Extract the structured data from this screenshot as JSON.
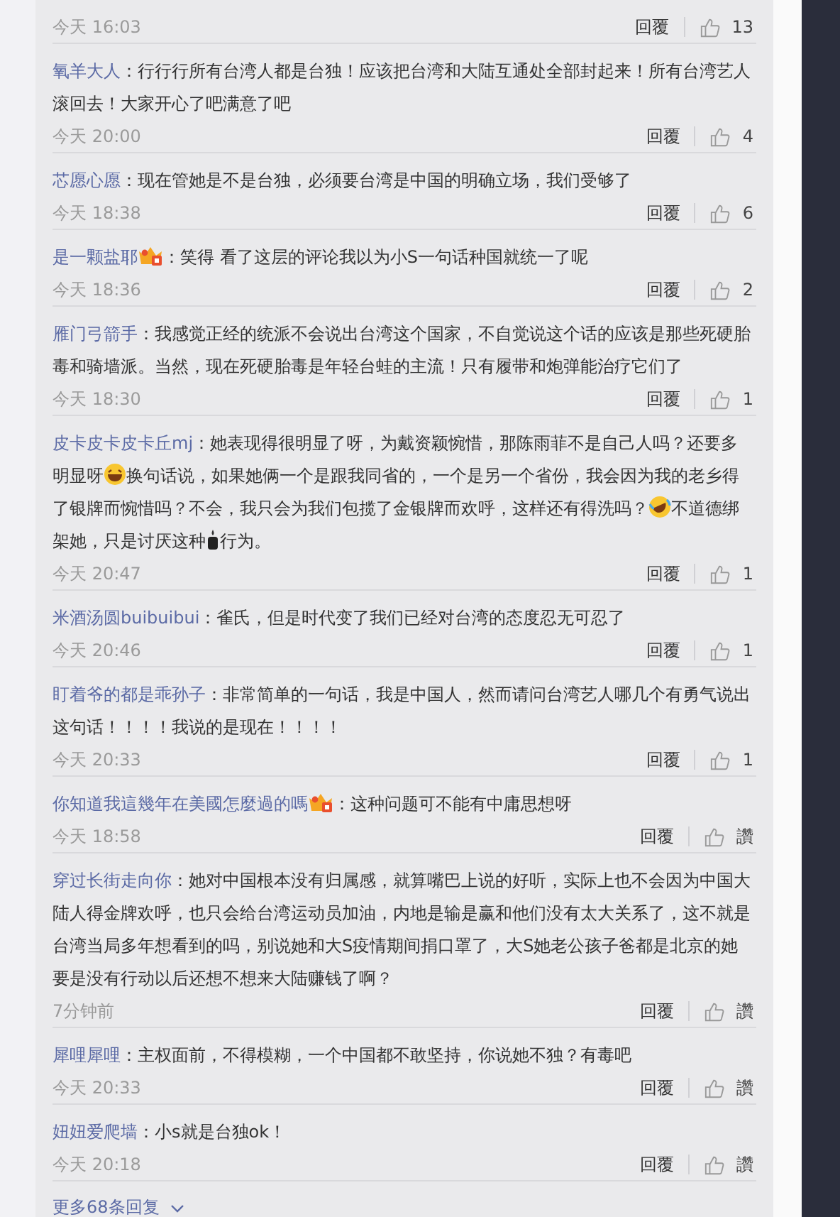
{
  "comments": [
    {
      "time": "今天 16:03",
      "reply": "回覆",
      "likes": "13"
    },
    {
      "user": "氧羊大人",
      "vip_badge": false,
      "parts": [
        {
          "kind": "text",
          "text": "：行行行所有台湾人都是台独！应该把台湾和大陆互通处全部封起来！所有台湾艺人滚回去！大家开心了吧满意了吧"
        }
      ],
      "time": "今天 20:00",
      "reply": "回覆",
      "likes": "4"
    },
    {
      "user": "芯愿心愿",
      "vip_badge": false,
      "parts": [
        {
          "kind": "text",
          "text": "：现在管她是不是台独，必须要台湾是中国的明确立场，我们受够了"
        }
      ],
      "time": "今天 18:38",
      "reply": "回覆",
      "likes": "6"
    },
    {
      "user": "是一颗盐耶",
      "vip_badge": true,
      "parts": [
        {
          "kind": "text",
          "text": "：笑得 看了这层的评论我以为小S一句话种国就统一了呢"
        }
      ],
      "time": "今天 18:36",
      "reply": "回覆",
      "likes": "2"
    },
    {
      "user": "雁门弓箭手",
      "vip_badge": false,
      "parts": [
        {
          "kind": "text",
          "text": "：我感觉正经的统派不会说出台湾这个国家，不自觉说这个话的应该是那些死硬胎毒和骑墙派。当然，现在死硬胎毒是年轻台蛙的主流！只有履带和炮弹能治疗它们了"
        }
      ],
      "time": "今天 18:30",
      "reply": "回覆",
      "likes": "1"
    },
    {
      "user": "皮卡皮卡皮卡丘mj",
      "vip_badge": false,
      "parts": [
        {
          "kind": "text",
          "text": "：她表现得很明显了呀，为戴资颖惋惜，那陈雨菲不是自己人吗？还要多明显呀"
        },
        {
          "kind": "laugh"
        },
        {
          "kind": "text",
          "text": "换句话说，如果她俩一个是跟我同省的，一个是另一个省份，我会因为我的老乡得了银牌而惋惜吗？不会，我只会为我们包揽了金银牌而欢呼，这样还有得洗吗？"
        },
        {
          "kind": "tears"
        },
        {
          "kind": "text",
          "text": "不道德绑架她，只是讨厌这种"
        },
        {
          "kind": "candle"
        },
        {
          "kind": "text",
          "text": "行为。"
        }
      ],
      "time": "今天 20:47",
      "reply": "回覆",
      "likes": "1"
    },
    {
      "user": "米酒汤圆buibuibui",
      "vip_badge": false,
      "parts": [
        {
          "kind": "text",
          "text": "：雀氏，但是时代变了我们已经对台湾的态度忍无可忍了"
        }
      ],
      "time": "今天 20:46",
      "reply": "回覆",
      "likes": "1"
    },
    {
      "user": "盯着爷的都是乖孙子",
      "vip_badge": false,
      "parts": [
        {
          "kind": "text",
          "text": "：非常简单的一句话，我是中国人，然而请问台湾艺人哪几个有勇气说出这句话！！！！我说的是现在！！！！"
        }
      ],
      "time": "今天 20:33",
      "reply": "回覆",
      "likes": "1"
    },
    {
      "user": "你知道我這幾年在美國怎麼過的嗎",
      "vip_badge": true,
      "parts": [
        {
          "kind": "text",
          "text": "：这种问题可不能有中庸思想呀"
        }
      ],
      "time": "今天 18:58",
      "reply": "回覆",
      "likes": "讚"
    },
    {
      "user": "穿过长街走向你",
      "vip_badge": false,
      "parts": [
        {
          "kind": "text",
          "text": "：她对中国根本没有归属感，就算嘴巴上说的好听，实际上也不会因为中国大陆人得金牌欢呼，也只会给台湾运动员加油，内地是输是赢和他们没有太大关系了，这不就是台湾当局多年想看到的吗，别说她和大S疫情期间捐口罩了，大S她老公孩子爸都是北京的她要是没有行动以后还想不想来大陆赚钱了啊？"
        }
      ],
      "time": "7分钟前",
      "reply": "回覆",
      "likes": "讚"
    },
    {
      "user": "犀哩犀哩",
      "vip_badge": false,
      "parts": [
        {
          "kind": "text",
          "text": "：主权面前，不得模糊，一个中国都不敢坚持，你说她不独？有毒吧"
        }
      ],
      "time": "今天 20:33",
      "reply": "回覆",
      "likes": "讚"
    },
    {
      "user": "妞妞爱爬墙",
      "vip_badge": false,
      "parts": [
        {
          "kind": "text",
          "text": "：小s就是台独ok！"
        }
      ],
      "time": "今天 20:18",
      "reply": "回覆",
      "likes": "讚"
    }
  ],
  "more_link": "更多68条回复"
}
